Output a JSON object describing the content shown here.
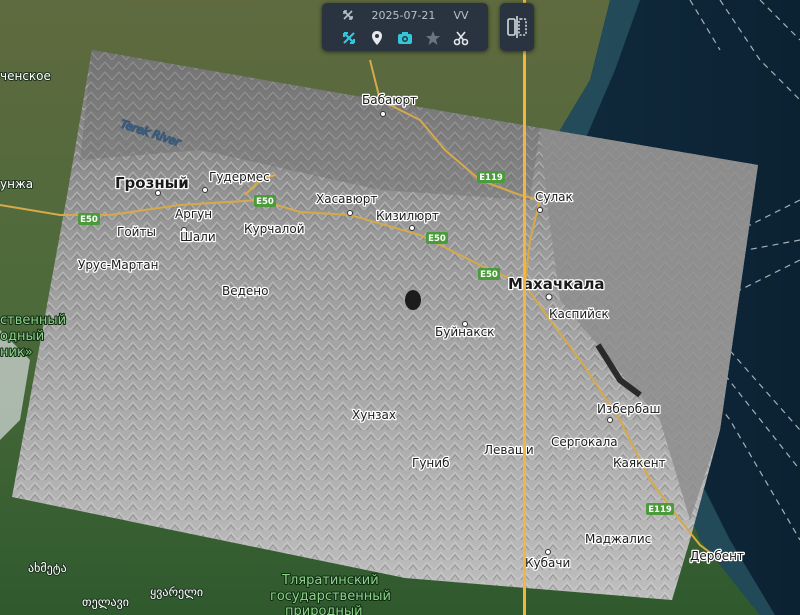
{
  "toolbar": {
    "date": "2025-07-21",
    "polarization": "VV",
    "icons": [
      "crossing-arrows-icon",
      "map-pin-icon",
      "camera-icon",
      "star-icon",
      "scissors-icon"
    ]
  },
  "split_view": {
    "icon": "split-view-icon"
  },
  "swipe_color": "#f4b63a",
  "map": {
    "cities": {
      "grozny": "Грозный",
      "gudermes": "Гудермес",
      "khasavyurt": "Хасавюрт",
      "kizilyurt": "Кизилюрт",
      "babayurt": "Бабаюрт",
      "sulak": "Сулак",
      "makhachkala": "Махачкала",
      "kaspiysk": "Каспийск",
      "buynaksk": "Буйнакск",
      "argun": "Аргун",
      "goyty": "Гойты",
      "shali": "Шали",
      "kurchaloy": "Курчалой",
      "urus_martan": "Урус-Мартан",
      "vedeno": "Ведено",
      "khunzakh": "Хунзах",
      "gunib": "Гуниб",
      "levashi": "Леваши",
      "sergokala": "Сергокала",
      "izberbash": "Избербаш",
      "kayakent": "Каякент",
      "madzhalis": "Маджалис",
      "kubachi": "Кубачи",
      "derbent": "Дербент",
      "kamenskoe": "ченское",
      "nzha": "унжа",
      "geo1": "ახმეტა",
      "geo2": "ყვარელი",
      "geo3": "თელავი"
    },
    "river": "Terek River",
    "reserves": {
      "left_line1": "ственный",
      "left_line2": "одный",
      "left_line3": "ник»",
      "south_line1": "Тляратинский",
      "south_line2": "государственный",
      "south_line3": "природный"
    },
    "roads": {
      "e50": "E50",
      "e119": "E119"
    }
  }
}
